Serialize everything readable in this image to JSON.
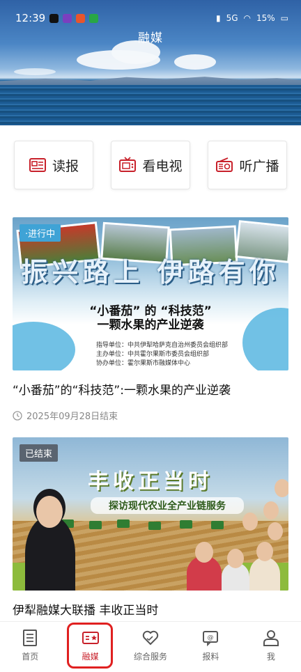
{
  "status_bar": {
    "time": "12:39",
    "battery": "15%",
    "network": "5G"
  },
  "header": {
    "title": "融媒"
  },
  "quick_links": [
    {
      "label": "读报",
      "icon": "newspaper-icon"
    },
    {
      "label": "看电视",
      "icon": "tv-icon"
    },
    {
      "label": "听广播",
      "icon": "radio-icon"
    }
  ],
  "cards": [
    {
      "badge": "·进行中",
      "banner_headline": "振兴路上 伊路有你",
      "banner_sub1": "“小番茄” 的 “科技范”",
      "banner_sub2": "一颗水果的产业逆袭",
      "banner_org1": "指导单位：中共伊犁哈萨克自治州委员会组织部",
      "banner_org2": "主办单位：中共霍尔果斯市委员会组织部",
      "banner_org3": "协办单位：霍尔果斯市融媒体中心",
      "title": "“小番茄”的“科技范”:一颗水果的产业逆袭",
      "meta": "2025年09月28日结束"
    },
    {
      "badge": "已结束",
      "banner_headline": "丰收正当时",
      "banner_sub": "探访现代农业全产业链服务",
      "title": "伊犁融媒大联播 丰收正当时"
    }
  ],
  "nav": [
    {
      "label": "首页",
      "icon": "home-doc-icon"
    },
    {
      "label": "融媒",
      "icon": "media-icon",
      "active": true
    },
    {
      "label": "综合服务",
      "icon": "heart-service-icon"
    },
    {
      "label": "报料",
      "icon": "report-icon"
    },
    {
      "label": "我",
      "icon": "user-icon"
    }
  ],
  "colors": {
    "accent": "#c8202a",
    "live_badge": "#3fa3d6",
    "ended_badge": "#5a6470"
  }
}
